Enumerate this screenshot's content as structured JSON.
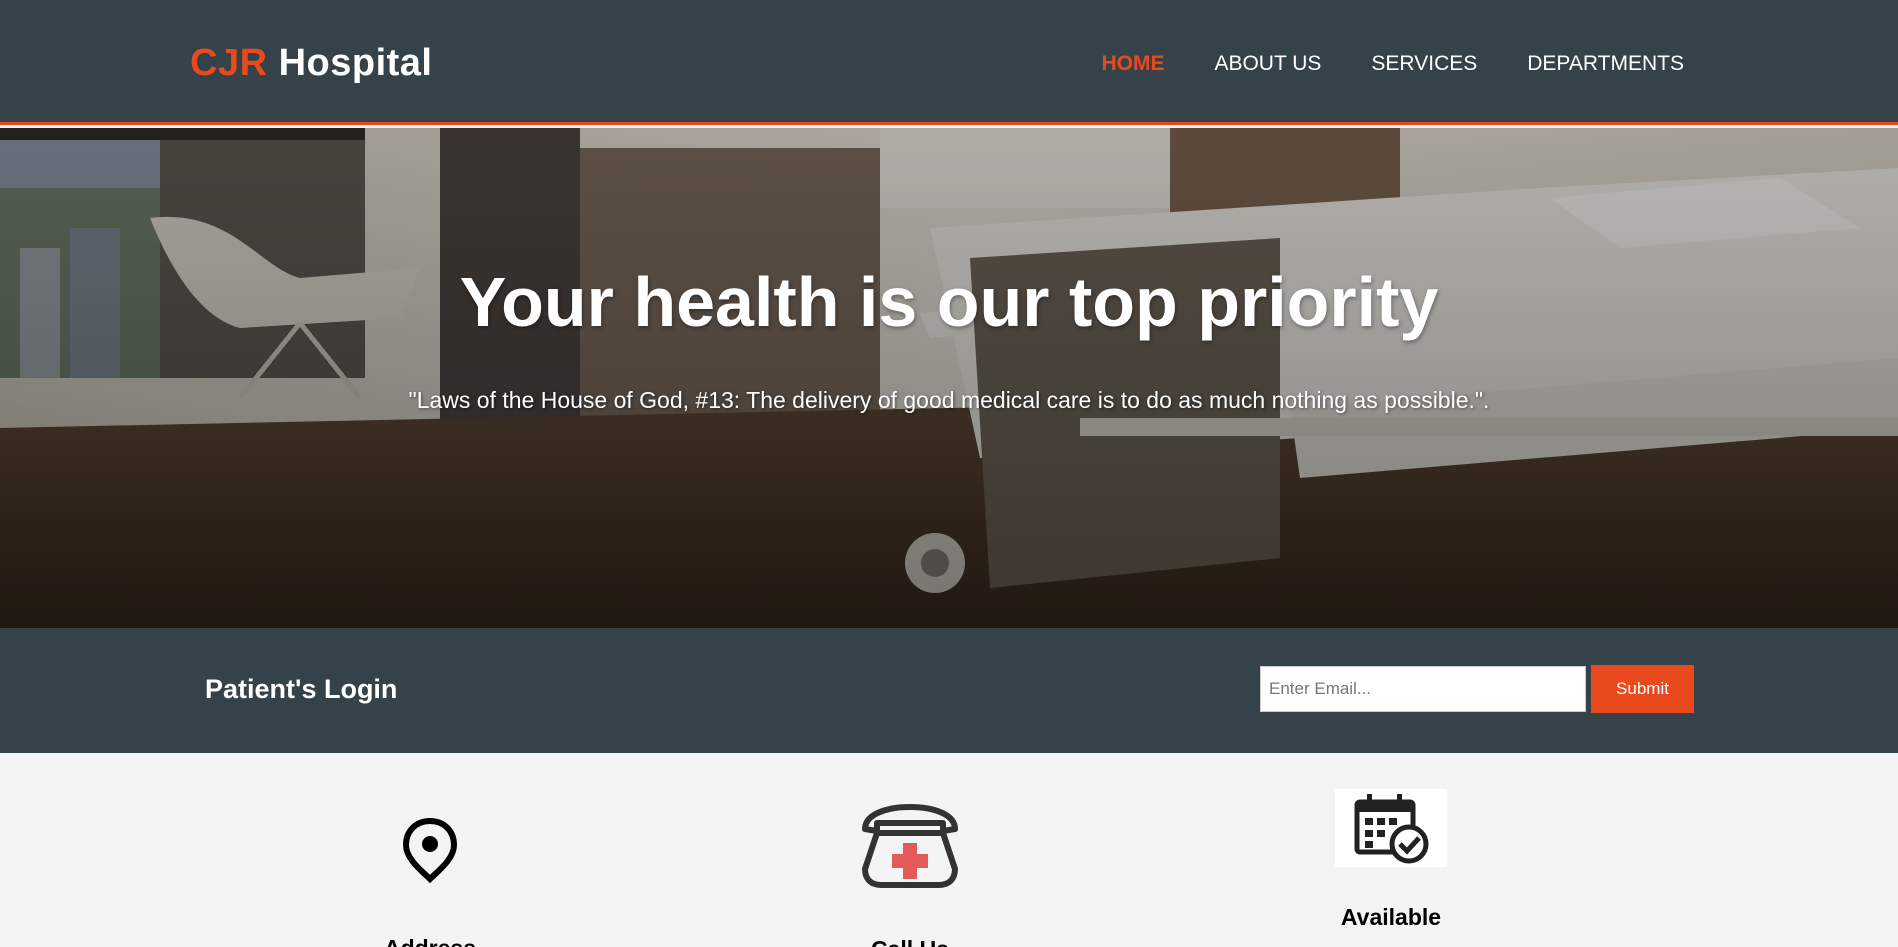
{
  "brand": {
    "accent": "CJR",
    "rest": " Hospital"
  },
  "nav": [
    {
      "label": "HOME",
      "active": true
    },
    {
      "label": "ABOUT US",
      "active": false
    },
    {
      "label": "SERVICES",
      "active": false
    },
    {
      "label": "DEPARTMENTS",
      "active": false
    }
  ],
  "hero": {
    "title": "Your health is our top priority",
    "quote": "\"Laws of the House of God, #13: The delivery of good medical care is to do as much nothing as possible.\"."
  },
  "login": {
    "title": "Patient's Login",
    "email_placeholder": "Enter Email...",
    "submit_label": "Submit"
  },
  "boxes": [
    {
      "icon": "map-pin-icon",
      "title": "Address"
    },
    {
      "icon": "medical-phone-icon",
      "title": "Call Us"
    },
    {
      "icon": "calendar-check-icon",
      "title": "Available"
    }
  ],
  "colors": {
    "dark": "#35424a",
    "accent": "#e8491d",
    "light": "#f4f4f4"
  }
}
